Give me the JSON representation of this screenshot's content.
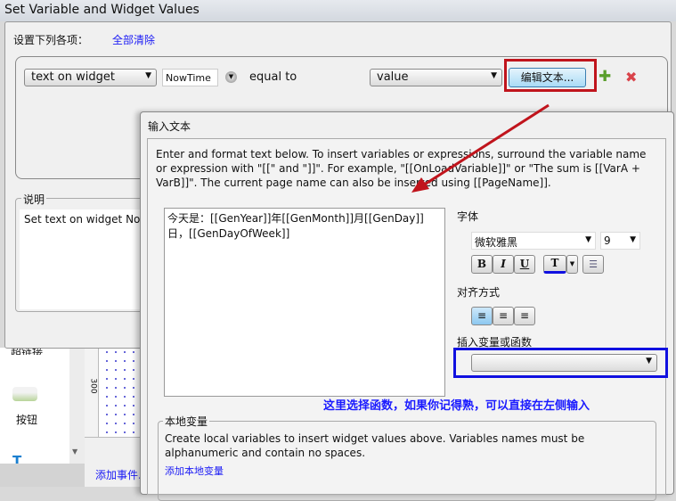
{
  "window": {
    "title": "Set Variable and Widget Values"
  },
  "back": {
    "set_label": "设置下列各项：",
    "clear_all": "全部清除",
    "row": {
      "target_type": "text on widget",
      "widget": "NowTime",
      "operator": "equal to",
      "value_type": "value",
      "edit_text_button": "编辑文本..."
    },
    "desc_legend": "说明",
    "desc_text": "Set text on widget NowTime"
  },
  "background": {
    "toolbox_item_cut": "超链接",
    "button_label": "按钮",
    "ruler_value": "300",
    "add_event": "添加事件..."
  },
  "dialog": {
    "title": "输入文本",
    "instructions": "Enter and format text below. To insert variables or expressions, surround the variable name or expression with \"[[\" and \"]]\". For example, \"[[OnLoadVariable]]\" or \"The sum is [[VarA + VarB]]\". The current page name can also be inserted using [[PageName]].",
    "editor_text": "今天是：[[GenYear]]年[[GenMonth]]月[[GenDay]]日，[[GenDayOfWeek]]",
    "font_label": "字体",
    "font_name": "微软雅黑",
    "font_size": "9",
    "bold": "B",
    "italic": "I",
    "underline": "U",
    "color_button": "T",
    "align_label": "对齐方式",
    "insert_label": "插入变量或函数",
    "insert_value": "",
    "local_legend": "本地变量",
    "local_text": "Create local variables to insert widget values above. Variables names must be alphanumeric and contain no spaces.",
    "add_local": "添加本地变量"
  },
  "annotation": {
    "text": "这里选择函数，如果你记得熟，可以直接在左侧输入",
    "color": "#1a1aff"
  },
  "colors": {
    "highlight_red": "#c0141c",
    "highlight_blue": "#1010e0",
    "link": "#1b1bf5"
  }
}
